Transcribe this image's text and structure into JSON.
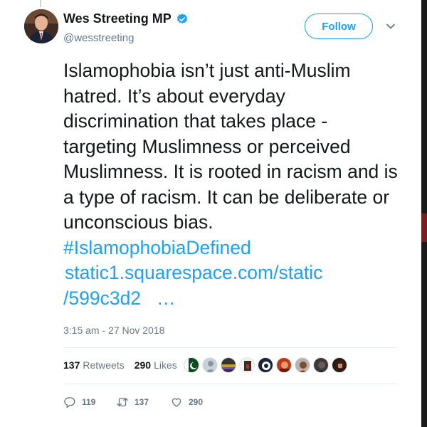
{
  "user": {
    "name": "Wes Streeting MP",
    "handle": "@wesstreeting",
    "verified": true,
    "follow_label": "Follow"
  },
  "tweet": {
    "lines": [
      "Islamophobia isn’t just anti-Muslim",
      "hatred. It’s about everyday",
      "discrimination that takes place -",
      "targeting Muslimness or perceived",
      "Muslimness. It is rooted in racism and is",
      "a type of racism. It can be deliberate or",
      "unconscious bias."
    ],
    "hashtag": "#IslamophobiaDefined",
    "link_line1": "static1.squarespace.com/static",
    "link_line2": "/599c3d2",
    "link_ellipsis": "…",
    "timestamp": "3:15 am - 27 Nov 2018"
  },
  "stats": {
    "retweets_count": "137",
    "retweets_label": "Retweets",
    "likes_count": "290",
    "likes_label": "Likes",
    "liker_count": 9
  },
  "actions": {
    "replies": "119",
    "retweets": "137",
    "likes": "290"
  },
  "colors": {
    "accent": "#1da1f2",
    "text": "#14171a",
    "muted": "#657786"
  }
}
